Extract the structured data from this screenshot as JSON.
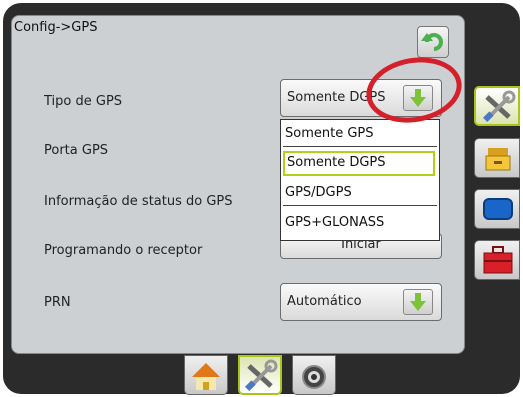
{
  "header": {
    "breadcrumb": "Config->GPS"
  },
  "rows": [
    {
      "label": "Tipo de GPS",
      "value": "Somente DGPS"
    },
    {
      "label": "Porta GPS"
    },
    {
      "label": "Informação de status do GPS"
    },
    {
      "label": "Programando o receptor",
      "button": "Iniciar"
    },
    {
      "label": "PRN",
      "value": "Automático"
    }
  ],
  "dropdown": {
    "options": [
      "Somente GPS",
      "Somente DGPS",
      "GPS/DGPS",
      "GPS+GLONASS"
    ],
    "selected_index": 1
  },
  "side_tabs": [
    {
      "icon": "tools-icon",
      "active": true
    },
    {
      "icon": "storage-icon",
      "active": false
    },
    {
      "icon": "display-icon",
      "active": false
    },
    {
      "icon": "toolbox-icon",
      "active": false
    }
  ],
  "bottom_tabs": [
    {
      "icon": "home-icon",
      "active": false
    },
    {
      "icon": "tools-icon",
      "active": true
    },
    {
      "icon": "gps-icon",
      "active": false
    }
  ],
  "colors": {
    "accent": "#a9c41a",
    "arrow": "#7dc238",
    "highlight_circle": "#d4202a"
  }
}
